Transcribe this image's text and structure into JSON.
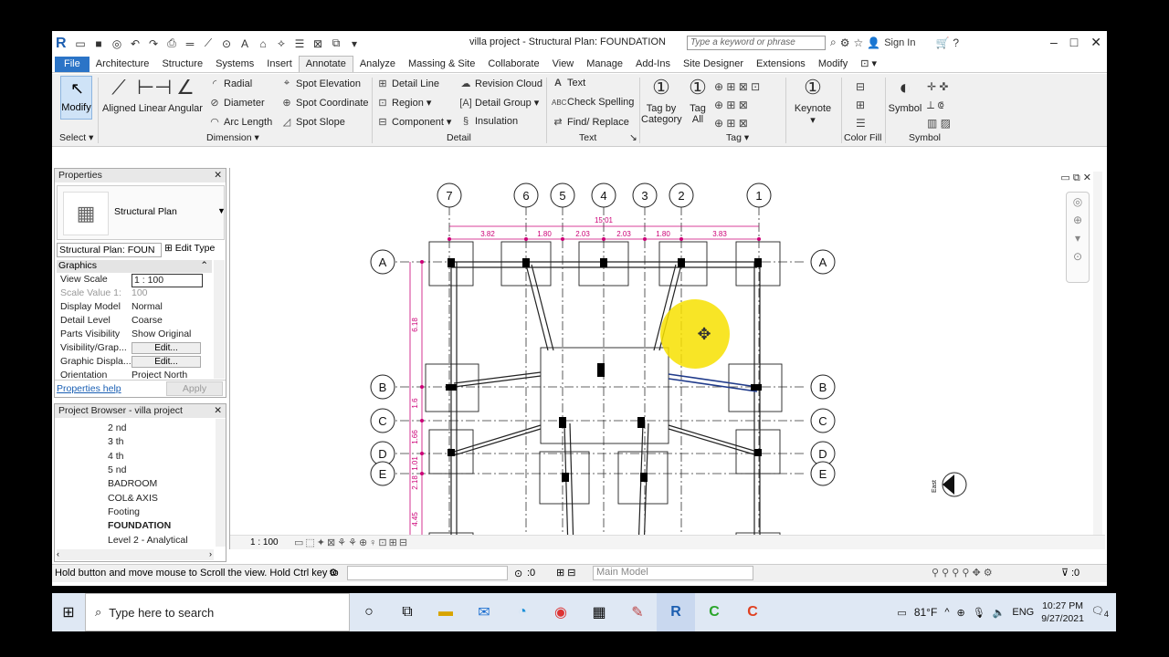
{
  "titlebar": {
    "doc_title": "villa project - Structural Plan: FOUNDATION",
    "search_placeholder": "Type a keyword or phrase",
    "sign_in": "Sign In"
  },
  "tabs": [
    "File",
    "Architecture",
    "Structure",
    "Systems",
    "Insert",
    "Annotate",
    "Analyze",
    "Massing & Site",
    "Collaborate",
    "View",
    "Manage",
    "Add-Ins",
    "Site Designer",
    "Extensions",
    "Modify"
  ],
  "ribbon": {
    "modify": "Modify",
    "select": "Select",
    "aligned": "Aligned",
    "linear": "Linear",
    "angular": "Angular",
    "radial": "Radial",
    "diameter": "Diameter",
    "arc_length": "Arc Length",
    "spot_elevation": "Spot Elevation",
    "spot_coordinate": "Spot Coordinate",
    "spot_slope": "Spot Slope",
    "dimension": "Dimension",
    "detail_line": "Detail Line",
    "region": "Region",
    "component": "Component",
    "revision_cloud": "Revision Cloud",
    "detail_group": "Detail Group",
    "insulation": "Insulation",
    "detail": "Detail",
    "text": "Text",
    "check_spelling": "Check Spelling",
    "find_replace": "Find/ Replace",
    "text_panel": "Text",
    "tag_by_category_1": "Tag by",
    "tag_by_category_2": "Category",
    "tag_all_1": "Tag",
    "tag_all_2": "All",
    "tag": "Tag",
    "keynote": "Keynote",
    "color_fill": "Color Fill",
    "symbol": "Symbol",
    "symbol_panel": "Symbol"
  },
  "properties": {
    "title": "Properties",
    "type_name": "Structural Plan",
    "selector": "Structural Plan: FOUN",
    "edit_type": "Edit Type",
    "group": "Graphics",
    "rows": [
      {
        "k": "View Scale",
        "v": "1 : 100"
      },
      {
        "k": "Scale Value   1:",
        "v": "100"
      },
      {
        "k": "Display Model",
        "v": "Normal"
      },
      {
        "k": "Detail Level",
        "v": "Coarse"
      },
      {
        "k": "Parts Visibility",
        "v": "Show Original"
      },
      {
        "k": "Visibility/Grap...",
        "v": "Edit..."
      },
      {
        "k": "Graphic Displa...",
        "v": "Edit..."
      },
      {
        "k": "Orientation",
        "v": "Project North"
      }
    ],
    "help": "Properties help",
    "apply": "Apply"
  },
  "browser": {
    "title": "Project Browser - villa project",
    "items": [
      "2 nd",
      "3 th",
      "4 th",
      "5 nd",
      "BADROOM",
      "COL& AXIS",
      "Footing",
      "FOUNDATION",
      "Level 2 - Analytical"
    ]
  },
  "drawing": {
    "grid_numbers": [
      "7",
      "6",
      "5",
      "4",
      "3",
      "2",
      "1"
    ],
    "grid_letters": [
      "A",
      "B",
      "C",
      "D",
      "E"
    ],
    "overall_dim": "15.01",
    "dims_top": [
      "3.82",
      "1.80",
      "2.03",
      "2.03",
      "1.80",
      "3.83"
    ],
    "dims_left": [
      "6.18",
      "1.6",
      "1.66",
      "1.01",
      "2.18",
      "4.45"
    ],
    "elevation_label": "East"
  },
  "canvas_bottom": {
    "scale": "1 : 100"
  },
  "status": {
    "message": "Hold button and move mouse to Scroll the view. Hold Ctrl key to",
    "coord": ":0",
    "model": "Main Model",
    "filter": ":0"
  },
  "taskbar": {
    "search": "Type here to search",
    "temp": "81°F",
    "lang": "ENG",
    "time": "10:27 PM",
    "date": "9/27/2021",
    "notif": "4"
  }
}
